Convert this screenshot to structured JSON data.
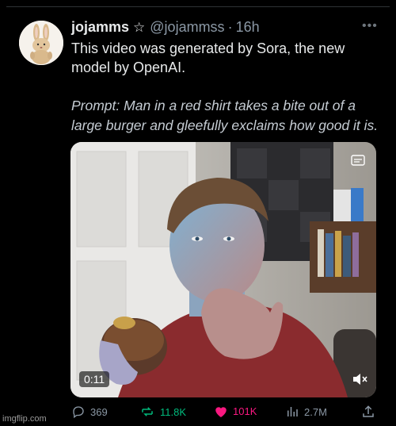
{
  "tweet": {
    "display_name": "jojamms",
    "handle": "@jojammss",
    "time": "16h",
    "text": "This video was generated by Sora, the new model by OpenAI.",
    "prompt": "Prompt: Man in a red shirt takes a bite out of a large burger and gleefully exclaims how good it is.",
    "more_label": "•••"
  },
  "video": {
    "timestamp": "0:11"
  },
  "actions": {
    "replies": "369",
    "reposts": "11.8K",
    "likes": "101K",
    "views": "2.7M"
  },
  "colors": {
    "background": "#000000",
    "text": "#e7e9ea",
    "muted": "#8b98a5",
    "repost": "#00ba7c",
    "like": "#f91880"
  },
  "watermark": "imgflip.com"
}
